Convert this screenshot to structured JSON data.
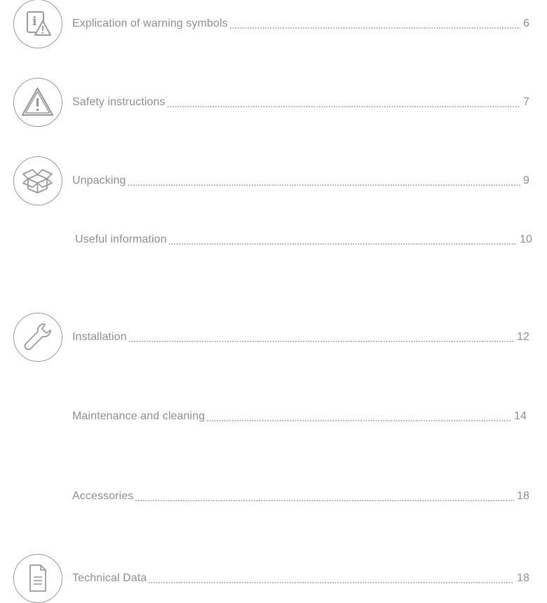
{
  "toc": {
    "entries": [
      {
        "title": "Explication of warning symbols",
        "page": "6",
        "icon": "info-warning-icon"
      },
      {
        "title": "Safety instructions",
        "page": "7",
        "icon": "warning-triangle-icon"
      },
      {
        "title": "Unpacking",
        "page": "9",
        "icon": "open-box-icon"
      },
      {
        "title": "Useful information",
        "page": "10"
      },
      {
        "title": "Installation",
        "page": "12",
        "icon": "wrench-icon"
      },
      {
        "title": "Maintenance and cleaning",
        "page": "14"
      },
      {
        "title": "Accessories",
        "page": "18"
      },
      {
        "title": "Technical Data",
        "page": "18",
        "icon": "document-icon"
      }
    ]
  }
}
